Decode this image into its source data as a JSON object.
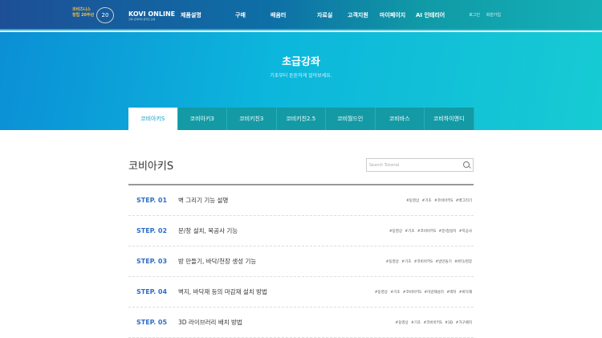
{
  "header": {
    "logo_text": "코비즈니스 창립 20주년",
    "badge": "20",
    "brand": "KOVI ONLINE",
    "brand_sub": "건축 인테리어 온라인 교육",
    "nav": [
      "제품설명",
      "구매",
      "배움터",
      "자료실",
      "고객지원",
      "마이페이지",
      "AI 인테리어"
    ],
    "util": [
      "로그인",
      "회원가입"
    ]
  },
  "hero": {
    "title": "초급강좌",
    "subtitle": "기초부터 튼튼하게 알아보세요."
  },
  "tabs": [
    "코비아키S",
    "코비아키3",
    "코비키친3",
    "코비키친2.5",
    "코비월드인",
    "코비바스",
    "코비하이앤디"
  ],
  "section": {
    "title": "코비아키S",
    "search_placeholder": "Search Tutorial"
  },
  "steps": [
    {
      "label": "STEP.",
      "num": "01",
      "title": "벽 그리기 기능 설명",
      "tags": "#동영상 #기초 #코비아키S #벽그리기"
    },
    {
      "label": "STEP.",
      "num": "02",
      "title": "문/창 설치, 목공사 기능",
      "tags": "#동영상 #기초 #코비아키S #문/창설치 #목공사"
    },
    {
      "label": "STEP.",
      "num": "03",
      "title": "방 만들기, 바닥/천장 생성 기능",
      "tags": "#동영상 #기초 #코비아키S #방만들기 #바닥/천장"
    },
    {
      "label": "STEP.",
      "num": "04",
      "title": "벽지, 바닥재 등의 마감재 설치 방법",
      "tags": "#동영상 #기초 #코비아키S #마감재설치 #벽지 #바닥재"
    },
    {
      "label": "STEP.",
      "num": "05",
      "title": "3D 라이브러리 배치 방법",
      "tags": "#동영상 #기초 #코비아키S #3D #가구배치"
    }
  ]
}
